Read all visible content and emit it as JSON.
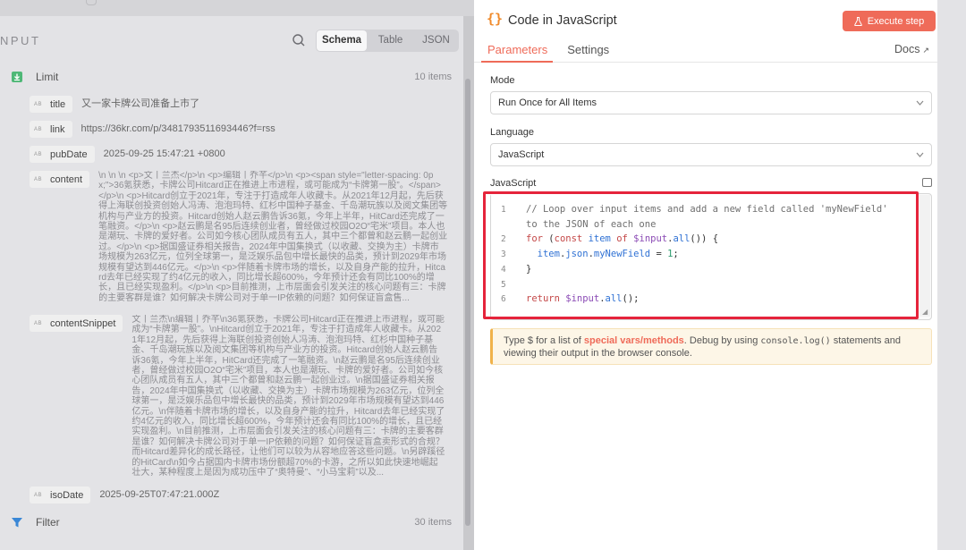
{
  "left": {
    "title": "NPUT",
    "views": [
      "Schema",
      "Table",
      "JSON"
    ],
    "nodes": [
      {
        "name": "Limit",
        "count": "10 items"
      },
      {
        "name": "Filter",
        "count": "30 items"
      }
    ],
    "fields": {
      "title": {
        "key": "title",
        "value": "又一家卡牌公司准备上市了"
      },
      "link": {
        "key": "link",
        "value": "https://36kr.com/p/3481793511693446?f=rss"
      },
      "pubDate": {
        "key": "pubDate",
        "value": "2025-09-25 15:47:21 +0800"
      },
      "content": {
        "key": "content",
        "value": "\\n \\n \\n <p>文丨兰杰</p>\\n <p>编辑丨乔芊</p>\\n <p><span style=\"letter-spacing: 0px;\">36氪获悉，卡牌公司Hitcard正在推进上市进程，或可能成为“卡牌第一股”。</span></p>\\n <p>Hitcard创立于2021年，专注于打造成年人收藏卡。从2021年12月起，先后获得上海联创投资创始人冯涛、泡泡玛特、红杉中国种子基金、千岛潮玩族以及阅文集团等机构与产业方的投资。Hitcard创始人赵云鹏告诉36氪，今年上半年，HitCard还完成了一笔融资。</p>\\n <p>赵云鹏是名95后连续创业者，曾经做过校园O2O“宅米”项目。本人也是潮玩、卡牌的爱好者。公司如今核心团队成员有五人，其中三个都曾和赵云鹏一起创业过。</p>\\n <p>据国盛证券相关报告，2024年中国集换式（以收藏、交换为主）卡牌市场规模为263亿元，位列全球第一，是泛娱乐品包中增长最快的品类，预计到2029年市场规模有望达到446亿元。</p>\\n <p>伴随着卡牌市场的增长，以及自身产能的拉升，Hitcard去年已经实现了约4亿元的收入，同比增长超600%，今年预计还会有同比100%的增长，且已经实现盈利。</p>\\n <p>目前推测，上市层面会引发关注的核心问题有三：卡牌的主要客群是谁？如何解决卡牌公司对于单一IP依赖的问题？如何保证盲盒售..."
      },
      "contentSnippet": {
        "key": "contentSnippet",
        "value": "文丨兰杰\\n编辑丨乔芊\\n36氪获悉，卡牌公司Hitcard正在推进上市进程，或可能成为“卡牌第一股”。\\nHitcard创立于2021年，专注于打造成年人收藏卡。从2021年12月起，先后获得上海联创投资创始人冯涛、泡泡玛特、红杉中国种子基金、千岛潮玩族以及阅文集团等机构与产业方的投资。Hitcard创始人赵云鹏告诉36氪，今年上半年，HitCard还完成了一笔融资。\\n赵云鹏是名95后连续创业者，曾经做过校园O2O“宅米”项目，本人也是潮玩、卡牌的爱好者。公司如今核心团队成员有五人，其中三个都曾和赵云鹏一起创业过。\\n据国盛证券相关报告，2024年中国集换式（以收藏、交换为主）卡牌市场规模为263亿元，位列全球第一，是泛娱乐品包中增长最快的品类，预计到2029年市场规模有望达到446亿元。\\n伴随着卡牌市场的增长，以及自身产能的拉升，Hitcard去年已经实现了约4亿元的收入，同比增长超600%，今年预计还会有同比100%的增长，且已经实现盈利。\\n目前推测，上市层面会引发关注的核心问题有三：卡牌的主要客群是谁？如何解决卡牌公司对于单一IP依赖的问题？如何保证盲盒卖形式的合规？而Hitcard差异化的成长路径，让他们可以较为从容地应答这些问题。\\n另辟蹊径的HitCard\\n如今占据国内卡牌市场份额超70%的卡游，之所以如此快速地崛起壮大，某种程度上是因为成功压中了“奥特曼”、“小马宝莉”以及..."
      },
      "isoDate": {
        "key": "isoDate",
        "value": "2025-09-25T07:47:21.000Z"
      }
    }
  },
  "panel": {
    "title": "Code in JavaScript",
    "execute_label": "Execute step",
    "tabs": [
      "Parameters",
      "Settings"
    ],
    "docs_label": "Docs",
    "mode_label": "Mode",
    "mode_value": "Run Once for All Items",
    "language_label": "Language",
    "language_value": "JavaScript",
    "code_label": "JavaScript",
    "code": {
      "comment_line1": "// Loop over input items and add a new field called 'myNewField'",
      "comment_line2": "to the JSON of each one",
      "line_numbers": [
        "1",
        "2",
        "3",
        "4",
        "5",
        "6"
      ]
    },
    "hint": {
      "prefix": "Type ",
      "dollar": "$",
      "mid": " for a list of ",
      "link": "special vars/methods",
      "after": ". Debug by using ",
      "code": "console.log()",
      "suffix": " statements and",
      "line2": "viewing their output in the browser console."
    }
  },
  "colors": {
    "accent": "#ef6b59",
    "highlight_box": "#e5243b",
    "hint_bg": "#fdf6e7"
  }
}
